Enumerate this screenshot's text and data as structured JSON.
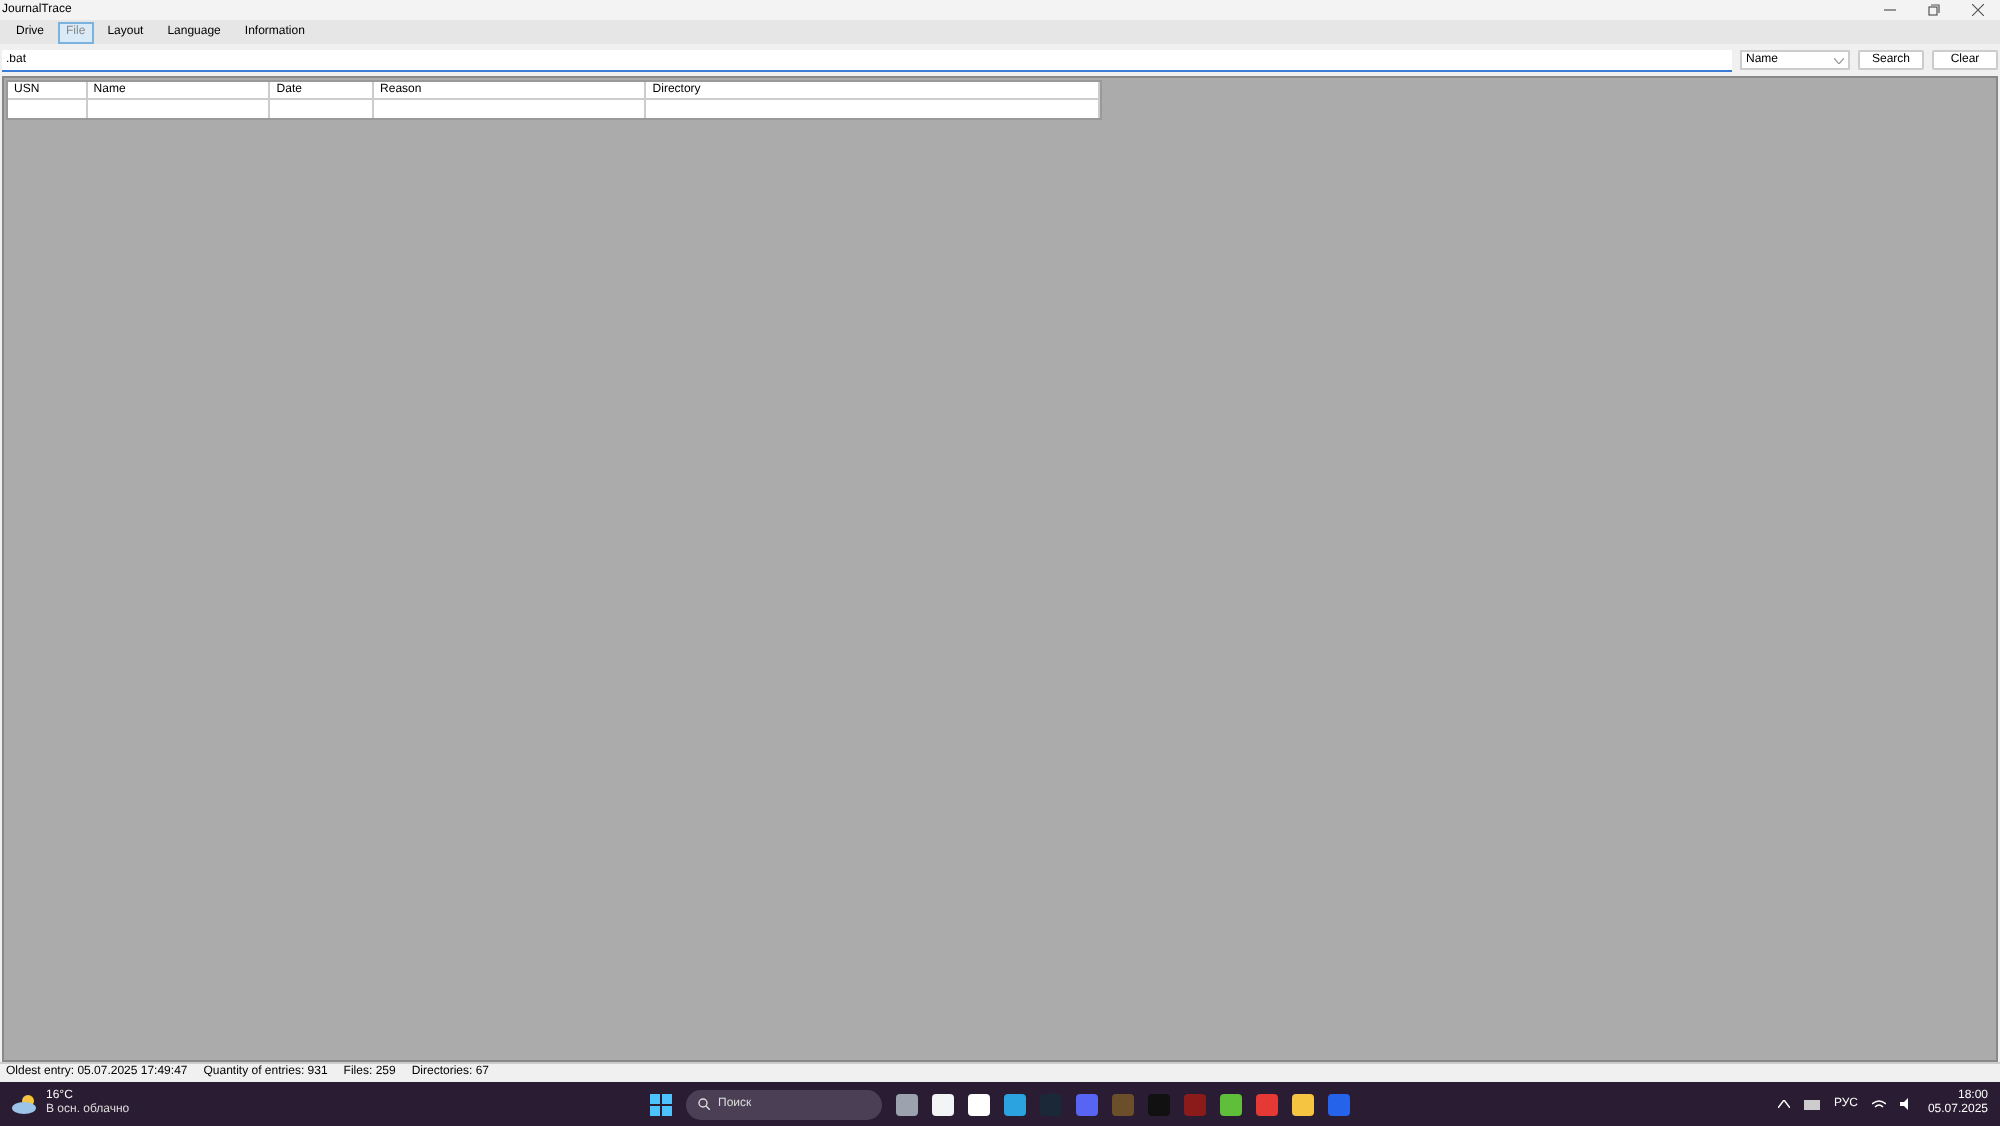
{
  "window": {
    "title": "JournalTrace"
  },
  "menu": [
    {
      "label": "Drive",
      "selected": false
    },
    {
      "label": "File",
      "selected": true
    },
    {
      "label": "Layout",
      "selected": false
    },
    {
      "label": "Language",
      "selected": false
    },
    {
      "label": "Information",
      "selected": false
    }
  ],
  "search": {
    "value": ".bat",
    "field": "Name",
    "buttons": [
      "Search",
      "Clear"
    ]
  },
  "table": {
    "columns": [
      "USN",
      "Name",
      "Date",
      "Reason",
      "Directory"
    ]
  },
  "status_bar": [
    {
      "label": "Oldest entry:",
      "value": "05.07.2025 17:49:47"
    },
    {
      "label": "Quantity of entries:",
      "value": "931"
    },
    {
      "label": "Files:",
      "value": "259"
    },
    {
      "label": "Directories:",
      "value": "67"
    }
  ],
  "taskbar": {
    "weather": {
      "temp": "16°C",
      "desc": "В осн. облачно"
    },
    "search_placeholder": "Поиск",
    "language": "РУС",
    "time": "18:00",
    "date": "05.07.2025"
  }
}
